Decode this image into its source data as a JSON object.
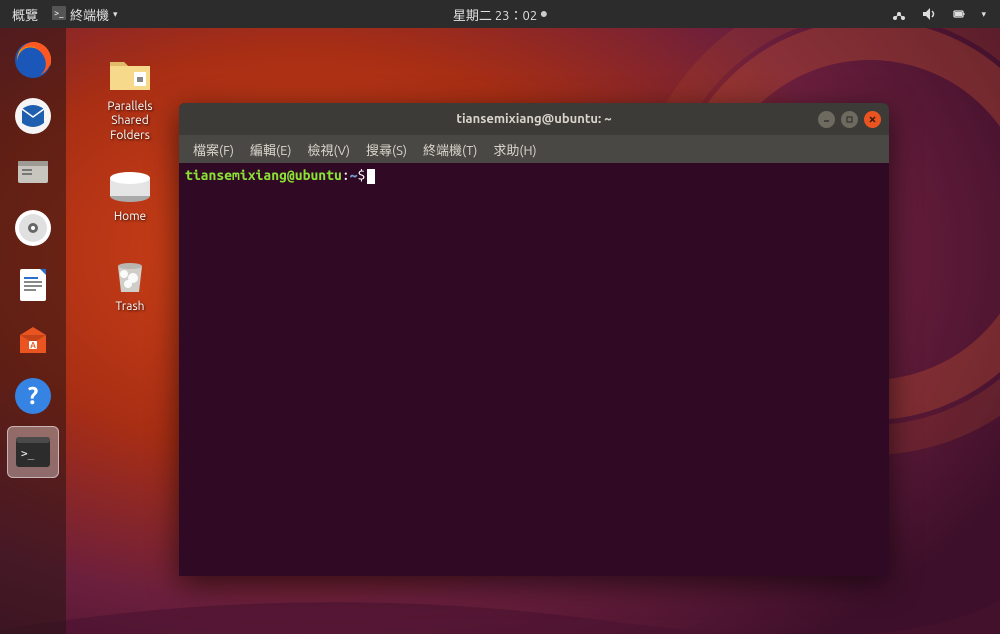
{
  "top_bar": {
    "activities": "概覽",
    "app_name": "終端機",
    "clock": "星期二 23：02",
    "tray": {
      "network": "network-icon",
      "volume": "volume-icon",
      "battery": "battery-icon",
      "dropdown": "dropdown-icon"
    }
  },
  "dock": {
    "items": [
      {
        "name": "firefox",
        "color": "#ff9500"
      },
      {
        "name": "thunderbird",
        "color": "#1f5fb0"
      },
      {
        "name": "files",
        "color": "#c8c4be"
      },
      {
        "name": "rhythmbox",
        "color": "#ffffff"
      },
      {
        "name": "libreoffice-writer",
        "color": "#ffffff"
      },
      {
        "name": "software",
        "color": "#e95420"
      },
      {
        "name": "help",
        "color": "#3584e4"
      },
      {
        "name": "terminal",
        "color": "#2c2c2c",
        "active": true
      }
    ]
  },
  "desktop_icons": [
    {
      "name": "parallels-shared-folders",
      "label": "Parallels\nShared\nFolders"
    },
    {
      "name": "home",
      "label": "Home"
    },
    {
      "name": "trash",
      "label": "Trash"
    }
  ],
  "terminal": {
    "title": "tiansemixiang@ubuntu: ~",
    "menu": {
      "file": "檔案(F)",
      "edit": "編輯(E)",
      "view": "檢視(V)",
      "search": "搜尋(S)",
      "terminal": "終端機(T)",
      "help": "求助(H)"
    },
    "prompt": {
      "user_host": "tiansemixiang@ubuntu",
      "separator": ":",
      "path": "~",
      "symbol": "$"
    }
  }
}
